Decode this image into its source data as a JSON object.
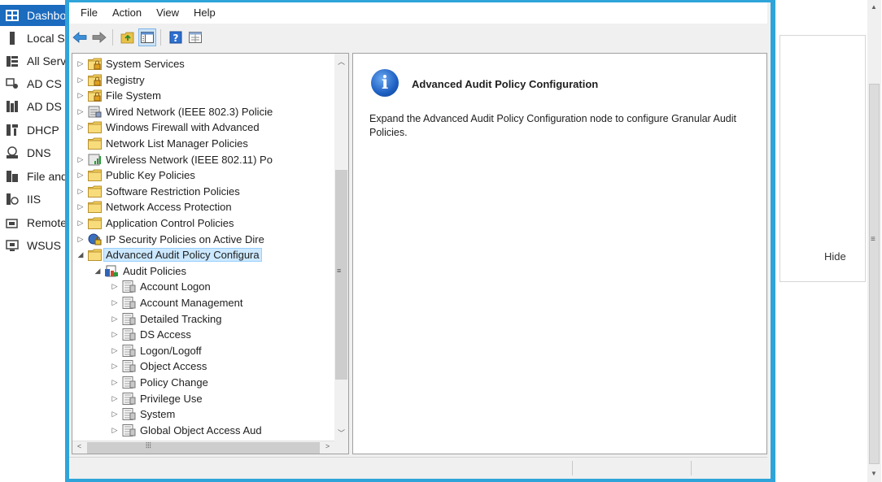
{
  "background": {
    "sidebar_items": [
      {
        "label": "Dashbo",
        "icon": "dashboard-icon",
        "selected": true
      },
      {
        "label": "Local S",
        "icon": "local-server-icon"
      },
      {
        "label": "All Serv",
        "icon": "all-servers-icon"
      },
      {
        "label": "AD CS",
        "icon": "ad-cs-icon"
      },
      {
        "label": "AD DS",
        "icon": "ad-ds-icon"
      },
      {
        "label": "DHCP",
        "icon": "dhcp-icon"
      },
      {
        "label": "DNS",
        "icon": "dns-icon"
      },
      {
        "label": "File and",
        "icon": "file-services-icon"
      },
      {
        "label": "IIS",
        "icon": "iis-icon"
      },
      {
        "label": "Remote",
        "icon": "remote-access-icon"
      },
      {
        "label": "WSUS",
        "icon": "wsus-icon"
      }
    ],
    "hide_label": "Hide"
  },
  "menu": [
    "File",
    "Action",
    "View",
    "Help"
  ],
  "toolbar": [
    "back-arrow-icon",
    "forward-arrow-icon",
    "up-folder-icon",
    "show-hide-tree-icon",
    "help-icon",
    "properties-icon"
  ],
  "tree": [
    {
      "label": "System Services",
      "expander": "▷",
      "icon": "lock-folder-icon"
    },
    {
      "label": "Registry",
      "expander": "▷",
      "icon": "lock-folder-icon"
    },
    {
      "label": "File System",
      "expander": "▷",
      "icon": "lock-folder-icon"
    },
    {
      "label": "Wired Network (IEEE 802.3) Policie",
      "expander": "▷",
      "icon": "network-policy-icon"
    },
    {
      "label": "Windows Firewall with Advanced",
      "expander": "▷",
      "icon": "folder-icon"
    },
    {
      "label": "Network List Manager Policies",
      "expander": "",
      "icon": "folder-icon"
    },
    {
      "label": "Wireless Network (IEEE 802.11) Po",
      "expander": "▷",
      "icon": "wireless-policy-icon"
    },
    {
      "label": "Public Key Policies",
      "expander": "▷",
      "icon": "folder-icon"
    },
    {
      "label": "Software Restriction Policies",
      "expander": "▷",
      "icon": "folder-icon"
    },
    {
      "label": "Network Access Protection",
      "expander": "▷",
      "icon": "folder-icon"
    },
    {
      "label": "Application Control Policies",
      "expander": "▷",
      "icon": "folder-icon"
    },
    {
      "label": "IP Security Policies on Active Dire",
      "expander": "▷",
      "icon": "ip-security-icon"
    },
    {
      "label": "Advanced Audit Policy Configura",
      "expander": "◢",
      "icon": "folder-icon",
      "selected": true
    },
    {
      "label": "Audit Policies",
      "expander": "◢",
      "icon": "audit-policies-icon"
    },
    {
      "label": "Account Logon",
      "expander": "▷",
      "icon": "policy-doc-icon"
    },
    {
      "label": "Account Management",
      "expander": "▷",
      "icon": "policy-doc-icon"
    },
    {
      "label": "Detailed Tracking",
      "expander": "▷",
      "icon": "policy-doc-icon"
    },
    {
      "label": "DS Access",
      "expander": "▷",
      "icon": "policy-doc-icon"
    },
    {
      "label": "Logon/Logoff",
      "expander": "▷",
      "icon": "policy-doc-icon"
    },
    {
      "label": "Object Access",
      "expander": "▷",
      "icon": "policy-doc-icon"
    },
    {
      "label": "Policy Change",
      "expander": "▷",
      "icon": "policy-doc-icon"
    },
    {
      "label": "Privilege Use",
      "expander": "▷",
      "icon": "policy-doc-icon"
    },
    {
      "label": "System",
      "expander": "▷",
      "icon": "policy-doc-icon"
    },
    {
      "label": "Global Object Access Aud",
      "expander": "▷",
      "icon": "policy-doc-icon"
    }
  ],
  "result": {
    "title": "Advanced Audit Policy Configuration",
    "description": "Expand the Advanced Audit Policy Configuration node to configure Granular Audit Policies."
  },
  "colors": {
    "window_border": "#2ea4d9",
    "selection": "#cce8ff",
    "sidebar_selected": "#1b6bbf"
  }
}
